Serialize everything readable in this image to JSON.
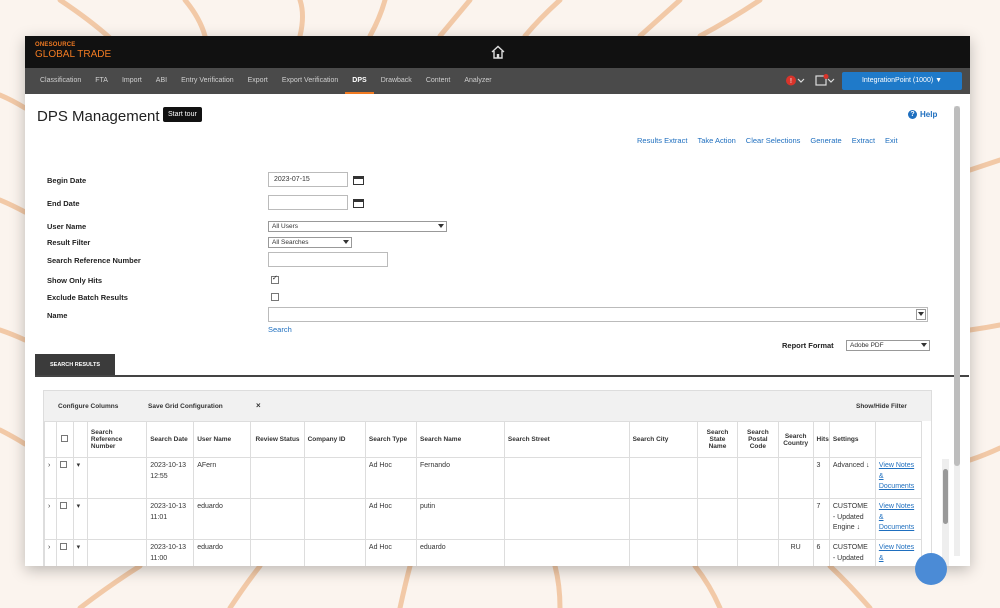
{
  "app": {
    "brand_small": "ONESOURCE",
    "brand_big": "GLOBAL TRADE"
  },
  "nav": {
    "tabs": [
      "Classification",
      "FTA",
      "Import",
      "ABI",
      "Entry Verification",
      "Export",
      "Export Verification",
      "DPS",
      "Drawback",
      "Content",
      "Analyzer"
    ],
    "active_tab": "DPS",
    "user_button": "IntegrationPoint (1000) ▼"
  },
  "page": {
    "title": "DPS Management",
    "tour_button": "Start tour",
    "help": "Help",
    "actions": [
      "Results Extract",
      "Take Action",
      "Clear Selections",
      "Generate",
      "Extract",
      "Exit"
    ]
  },
  "form": {
    "begin_date_label": "Begin Date",
    "begin_date_value": "2023-07-15",
    "end_date_label": "End Date",
    "end_date_value": "",
    "user_name_label": "User Name",
    "user_name_value": "All Users",
    "result_filter_label": "Result Filter",
    "result_filter_value": "All Searches",
    "search_ref_label": "Search Reference Number",
    "search_ref_value": "",
    "show_only_hits_label": "Show Only Hits",
    "show_only_hits_checked": true,
    "exclude_batch_label": "Exclude Batch Results",
    "exclude_batch_checked": false,
    "name_label": "Name",
    "name_value": "",
    "search_link": "Search",
    "report_format_label": "Report Format",
    "report_format_value": "Adobe PDF"
  },
  "results": {
    "tab_label": "SEARCH RESULTS",
    "toolbar": {
      "configure_columns": "Configure Columns",
      "save_grid": "Save Grid Configuration",
      "close": "×",
      "show_hide_filter": "Show/Hide Filter"
    },
    "columns": [
      "Search Reference Number",
      "Search Date",
      "User Name",
      "Review Status",
      "Company ID",
      "Search Type",
      "Search Name",
      "Search Street",
      "Search City",
      "Search State Name",
      "Search Postal Code",
      "Search Country",
      "Hits",
      "Settings"
    ],
    "rows": [
      {
        "date": "2023-10-13 12:55",
        "user": "AFern",
        "type": "Ad Hoc",
        "name": "Fernando",
        "country": "",
        "hits": "3",
        "settings": "Advanced ↓",
        "links": "View Notes & Documents"
      },
      {
        "date": "2023-10-13 11:01",
        "user": "eduardo",
        "type": "Ad Hoc",
        "name": "putin",
        "country": "",
        "hits": "7",
        "settings": "CUSTOME - Updated Engine ↓",
        "links": "View Notes & Documents"
      },
      {
        "date": "2023-10-13 11:00",
        "user": "eduardo",
        "type": "Ad Hoc",
        "name": "eduardo",
        "country": "RU",
        "hits": "6",
        "settings": "CUSTOME - Updated",
        "links": "View Notes &"
      }
    ]
  }
}
